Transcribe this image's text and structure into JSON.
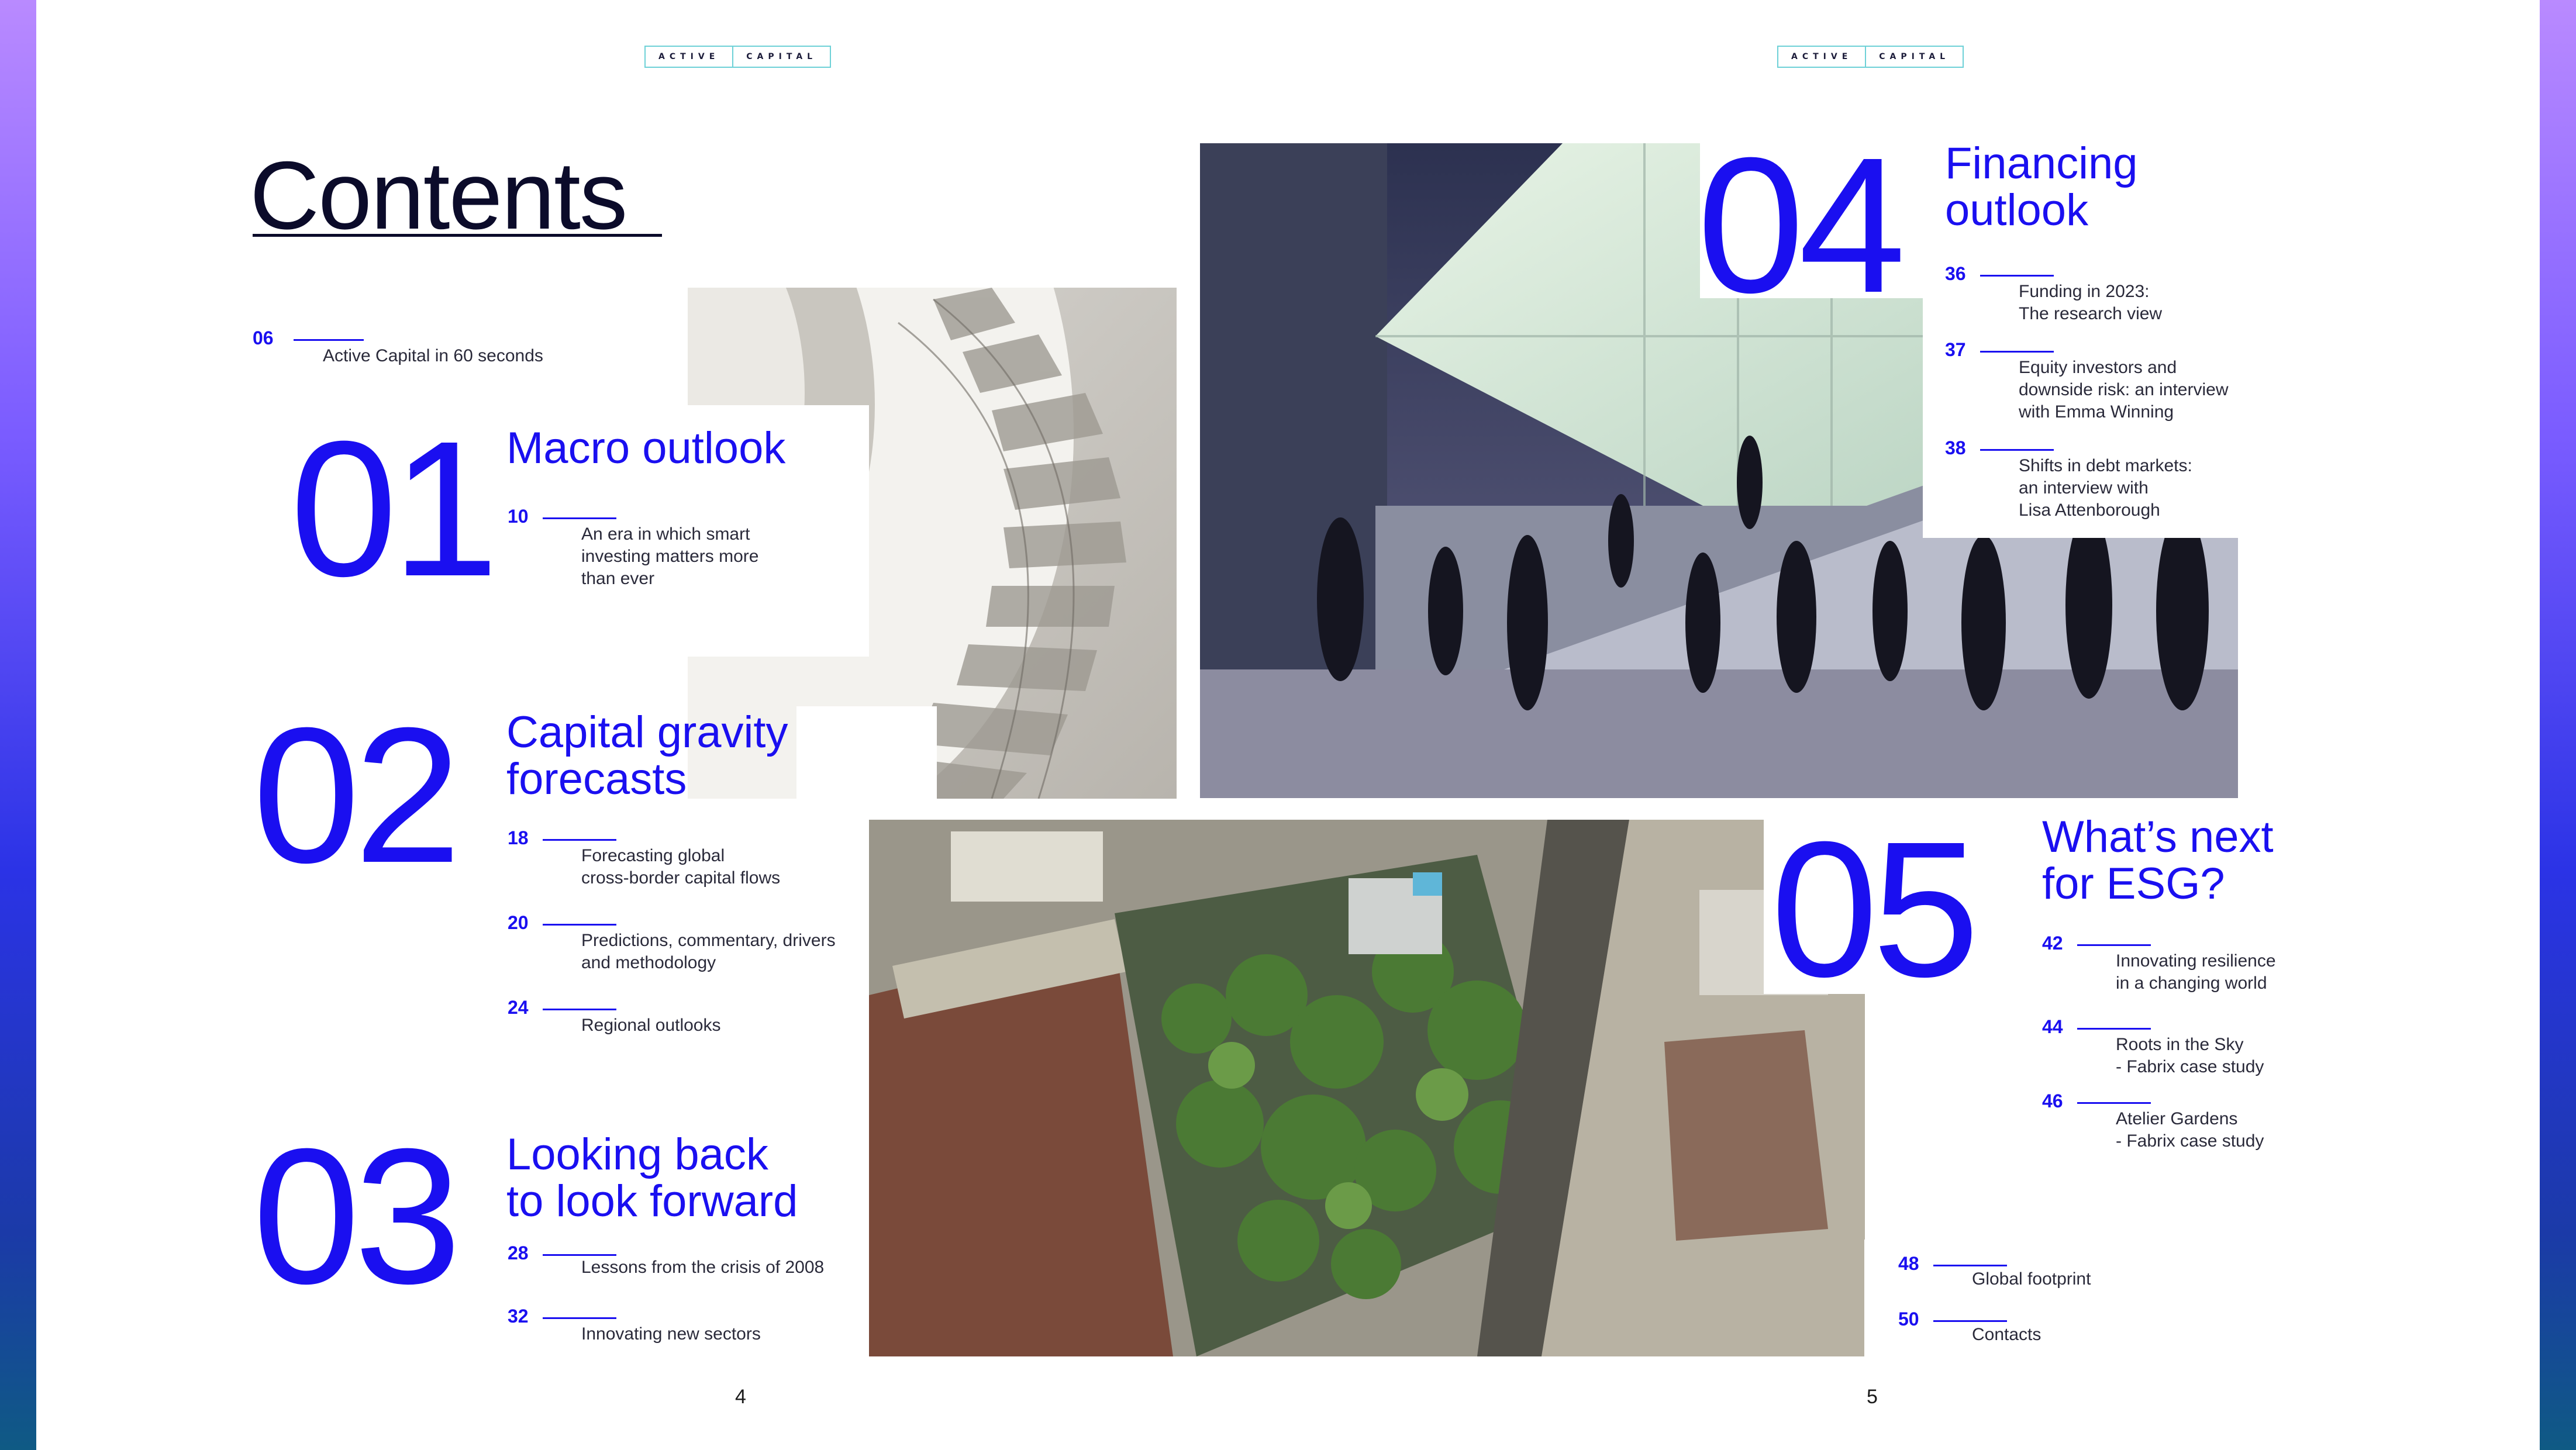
{
  "brand": {
    "left": "ACTIVE",
    "right": "CAPITAL"
  },
  "title": "Contents",
  "intro": {
    "page": "06",
    "text": "Active Capital in 60 seconds"
  },
  "sections": [
    {
      "number": "01",
      "title": [
        "Macro outlook"
      ],
      "entries": [
        {
          "page": "10",
          "lines": [
            "An era in which smart",
            "investing matters more",
            "than ever"
          ]
        }
      ]
    },
    {
      "number": "02",
      "title": [
        "Capital gravity",
        "forecasts"
      ],
      "entries": [
        {
          "page": "18",
          "lines": [
            "Forecasting global",
            "cross-border capital flows"
          ]
        },
        {
          "page": "20",
          "lines": [
            "Predictions, commentary, drivers",
            "and methodology"
          ]
        },
        {
          "page": "24",
          "lines": [
            "Regional outlooks"
          ]
        }
      ]
    },
    {
      "number": "03",
      "title": [
        "Looking back",
        "to look forward"
      ],
      "entries": [
        {
          "page": "28",
          "lines": [
            "Lessons from the crisis of 2008"
          ]
        },
        {
          "page": "32",
          "lines": [
            "Innovating new sectors"
          ]
        }
      ]
    },
    {
      "number": "04",
      "title": [
        "Financing",
        "outlook"
      ],
      "entries": [
        {
          "page": "36",
          "lines": [
            "Funding in 2023:",
            "The research view"
          ]
        },
        {
          "page": "37",
          "lines": [
            "Equity investors and",
            "downside risk: an interview",
            "with Emma Winning"
          ]
        },
        {
          "page": "38",
          "lines": [
            "Shifts in debt markets:",
            "an interview with",
            "Lisa Attenborough"
          ]
        }
      ]
    },
    {
      "number": "05",
      "title": [
        "What’s next",
        "for ESG?"
      ],
      "entries": [
        {
          "page": "42",
          "lines": [
            "Innovating resilience",
            "in a changing world"
          ]
        },
        {
          "page": "44",
          "lines": [
            "Roots in the Sky",
            "- Fabrix case study"
          ]
        },
        {
          "page": "46",
          "lines": [
            "Atelier Gardens",
            "- Fabrix case study"
          ]
        }
      ]
    }
  ],
  "extras": [
    {
      "page": "48",
      "text": "Global footprint"
    },
    {
      "page": "50",
      "text": "Contacts"
    }
  ],
  "page_numbers": {
    "left": "4",
    "right": "5"
  },
  "images": {
    "staircase": "spiral-staircase-photo",
    "commuters": "commuters-walking-photo",
    "rooftop": "green-rooftop-aerial-photo"
  },
  "colors": {
    "accent": "#1a0ff0",
    "text": "#0b0b2a",
    "brand_border": "#6ed1d7"
  }
}
